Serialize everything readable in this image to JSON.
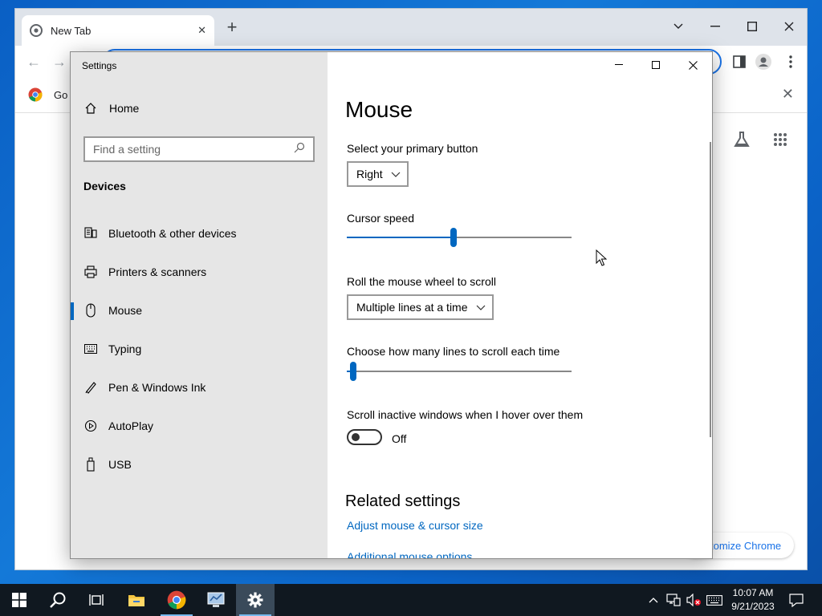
{
  "browser": {
    "tab_title": "New Tab",
    "bookmark_label": "Go",
    "customize_label": "Customize Chrome",
    "customize_visible": "tomize Chrome"
  },
  "settings": {
    "window_title": "Settings",
    "nav": {
      "home_label": "Home",
      "search_placeholder": "Find a setting",
      "section_label": "Devices",
      "items": [
        {
          "label": "Bluetooth & other devices",
          "icon": "bluetooth-devices-icon"
        },
        {
          "label": "Printers & scanners",
          "icon": "printer-icon"
        },
        {
          "label": "Mouse",
          "icon": "mouse-icon",
          "active": true
        },
        {
          "label": "Typing",
          "icon": "keyboard-icon"
        },
        {
          "label": "Pen & Windows Ink",
          "icon": "pen-icon"
        },
        {
          "label": "AutoPlay",
          "icon": "autoplay-icon"
        },
        {
          "label": "USB",
          "icon": "usb-icon"
        }
      ]
    },
    "page": {
      "title": "Mouse",
      "primary_button_label": "Select your primary button",
      "primary_button_value": "Right",
      "cursor_speed_label": "Cursor speed",
      "cursor_speed_fraction": 0.475,
      "scroll_mode_label": "Roll the mouse wheel to scroll",
      "scroll_mode_value": "Multiple lines at a time",
      "lines_label": "Choose how many lines to scroll each time",
      "lines_fraction": 0.03,
      "inactive_scroll_label": "Scroll inactive windows when I hover over them",
      "inactive_scroll_state": "Off",
      "related_title": "Related settings",
      "link_adjust": "Adjust mouse & cursor size",
      "link_additional": "Additional mouse options"
    }
  },
  "taskbar": {
    "time": "10:07 AM",
    "date": "9/21/2023"
  },
  "colors": {
    "accent": "#0067c0",
    "nav_bg": "#e6e6e6",
    "taskbar_bg": "#101820",
    "chrome_blue": "#1a73e8"
  }
}
